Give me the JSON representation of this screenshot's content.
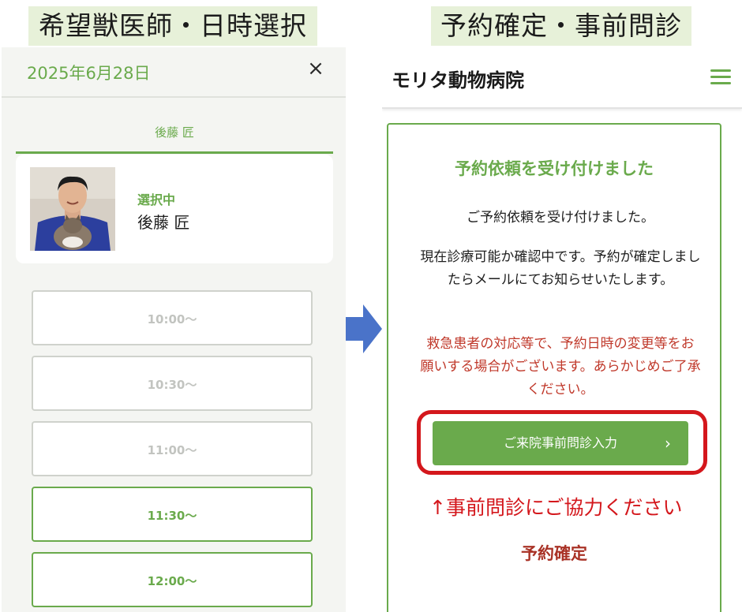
{
  "captions": {
    "left": "希望獣医師・日時選択",
    "right": "予約確定・事前問診"
  },
  "left_panel": {
    "date": "2025年6月28日",
    "close_icon": "×",
    "vet_tab": "後藤 匠",
    "vet_card": {
      "status": "選択中",
      "name": "後藤 匠"
    },
    "slots": [
      {
        "time": "10:00〜",
        "available": false
      },
      {
        "time": "10:30〜",
        "available": false
      },
      {
        "time": "11:00〜",
        "available": false
      },
      {
        "time": "11:30〜",
        "available": true
      },
      {
        "time": "12:00〜",
        "available": true
      }
    ]
  },
  "right_panel": {
    "clinic_name": "モリタ動物病院",
    "menu_icon": "hamburger-icon",
    "heading": "予約依頼を受け付けました",
    "message1": "ご予約依頼を受け付けました。",
    "message2": "現在診療可能か確認中です。予約が確定しましたらメールにてお知らせいたします。",
    "warning": "救急患者の対応等で、予約日時の変更等をお願いする場合がございます。あらかじめご了承ください。",
    "cta_label": "ご来院事前問診入力",
    "cta_chevron": "›",
    "annotation": "↑事前問診にご協力ください",
    "section_title": "予約確定"
  },
  "colors": {
    "accent": "#6aaa4c",
    "warning": "#c0392b",
    "highlight": "#d4171c",
    "caption_bg": "#e7f1d9"
  }
}
